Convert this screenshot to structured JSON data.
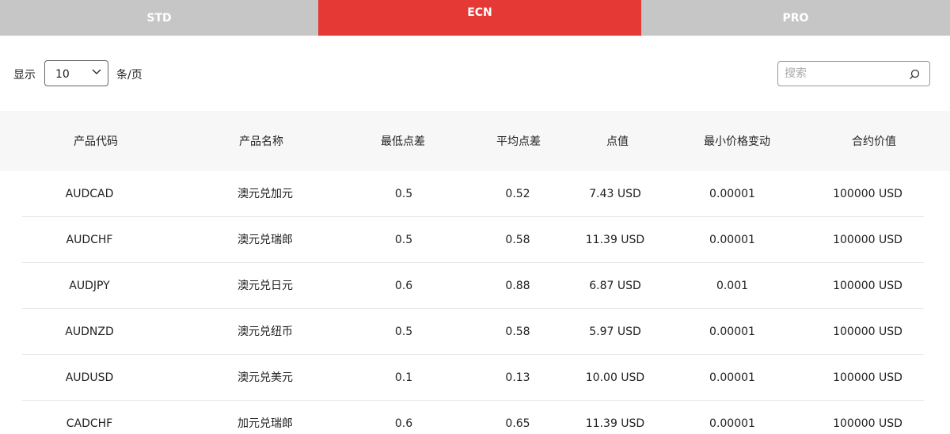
{
  "tabs": [
    {
      "label": "STD",
      "active": false
    },
    {
      "label": "ECN",
      "active": true
    },
    {
      "label": "PRO",
      "active": false
    }
  ],
  "colors": {
    "accent": "#e53935",
    "tab_inactive": "#c6c6c6",
    "header_bg": "#f7f7f7"
  },
  "toolbar": {
    "show_label": "显示",
    "page_size": "10",
    "per_page_label": "条/页",
    "search_placeholder": "搜索",
    "icons": {
      "dropdown": "chevron-down-icon",
      "search": "search-icon"
    }
  },
  "table": {
    "headers": [
      "产品代码",
      "产品名称",
      "最低点差",
      "平均点差",
      "点值",
      "最小价格变动",
      "合约价值"
    ],
    "rows": [
      [
        "AUDCAD",
        "澳元兑加元",
        "0.5",
        "0.52",
        "7.43 USD",
        "0.00001",
        "100000 USD"
      ],
      [
        "AUDCHF",
        "澳元兑瑞郎",
        "0.5",
        "0.58",
        "11.39 USD",
        "0.00001",
        "100000 USD"
      ],
      [
        "AUDJPY",
        "澳元兑日元",
        "0.6",
        "0.88",
        "6.87 USD",
        "0.001",
        "100000 USD"
      ],
      [
        "AUDNZD",
        "澳元兑纽币",
        "0.5",
        "0.58",
        "5.97 USD",
        "0.00001",
        "100000 USD"
      ],
      [
        "AUDUSD",
        "澳元兑美元",
        "0.1",
        "0.13",
        "10.00 USD",
        "0.00001",
        "100000 USD"
      ],
      [
        "CADCHF",
        "加元兑瑞郎",
        "0.6",
        "0.65",
        "11.39 USD",
        "0.00001",
        "100000 USD"
      ]
    ]
  }
}
